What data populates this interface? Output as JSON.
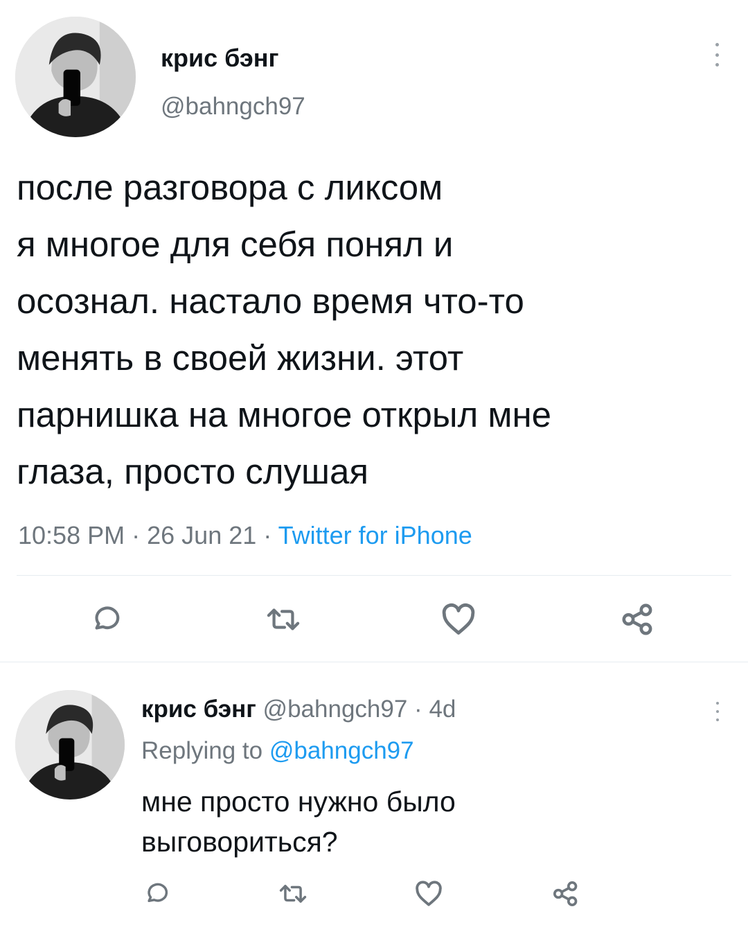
{
  "main_tweet": {
    "author_name": "крис бэнг",
    "author_handle": "@bahngch97",
    "text_lines": [
      "после разговора с ликсом",
      "я многое для себя понял и",
      "осознал. настало время что-то",
      "менять в своей жизни. этот",
      "парнишка на многое открыл мне",
      "глаза, просто слушая"
    ],
    "time": "10:58 PM",
    "date": "26 Jun 21",
    "separator": "·",
    "source": "Twitter for iPhone",
    "actions": [
      "reply-icon",
      "retweet-icon",
      "like-icon",
      "share-icon"
    ]
  },
  "reply_tweet": {
    "author_name": "крис бэнг",
    "author_handle": "@bahngch97",
    "age": "4d",
    "separator": "·",
    "replying_prefix": "Replying to",
    "replying_handle": "@bahngch97",
    "text_lines": [
      "мне просто нужно было",
      "выговориться?"
    ],
    "actions": [
      "reply-icon",
      "retweet-icon",
      "like-icon",
      "share-icon"
    ]
  },
  "colors": {
    "text": "#0f1419",
    "secondary": "#6e767d",
    "accent": "#1d9bf0",
    "divider": "#e6ecf0"
  }
}
